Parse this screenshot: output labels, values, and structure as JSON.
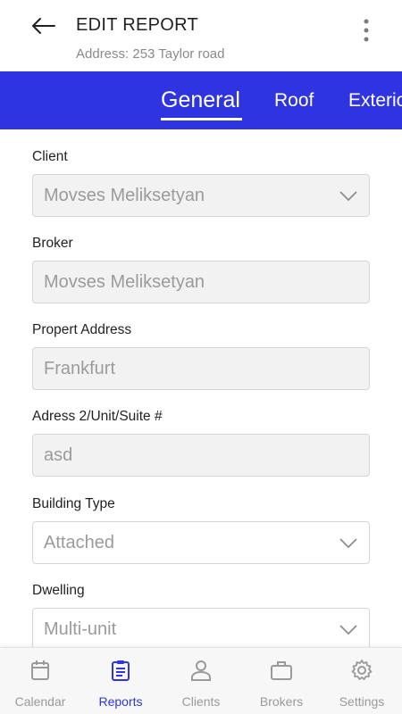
{
  "header": {
    "title": "EDIT REPORT",
    "subtitle": "Address: 253 Taylor road"
  },
  "tabs": [
    {
      "label": "General",
      "active": true
    },
    {
      "label": "Roof",
      "active": false
    },
    {
      "label": "Exterio",
      "active": false
    }
  ],
  "form": {
    "client": {
      "label": "Client",
      "value": "Movses Meliksetyan"
    },
    "broker": {
      "label": "Broker",
      "value": "Movses Meliksetyan"
    },
    "property_address": {
      "label": "Propert Address",
      "value": "Frankfurt"
    },
    "address2": {
      "label": "Adress 2/Unit/Suite #",
      "value": "asd"
    },
    "building_type": {
      "label": "Building Type",
      "value": "Attached"
    },
    "dwelling": {
      "label": "Dwelling",
      "value": "Multi-unit"
    }
  },
  "bottom_nav": [
    {
      "label": "Calendar",
      "icon": "calendar-icon",
      "active": false
    },
    {
      "label": "Reports",
      "icon": "clipboard-icon",
      "active": true
    },
    {
      "label": "Clients",
      "icon": "person-icon",
      "active": false
    },
    {
      "label": "Brokers",
      "icon": "briefcase-icon",
      "active": false
    },
    {
      "label": "Settings",
      "icon": "gear-icon",
      "active": false
    }
  ],
  "colors": {
    "accent": "#2e35e0",
    "inactive": "#9a9a9a"
  }
}
